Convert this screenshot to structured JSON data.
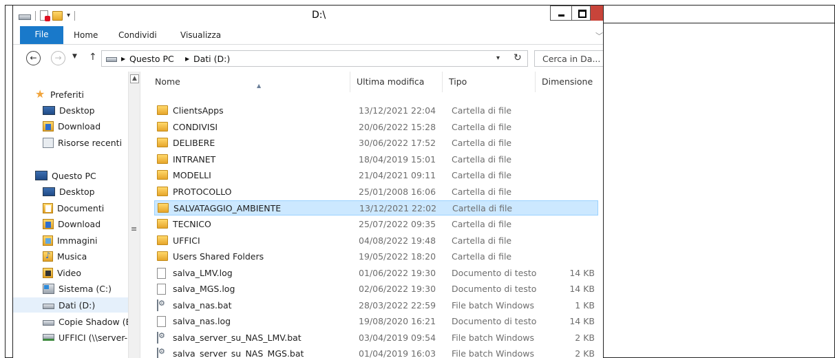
{
  "window": {
    "title": "D:\\",
    "ribbon_tabs": [
      "File",
      "Home",
      "Condividi",
      "Visualizza"
    ]
  },
  "addressbar": {
    "segments": [
      "Questo PC",
      "Dati (D:)"
    ],
    "search_placeholder": "Cerca in Da..."
  },
  "navpane": {
    "favorites_label": "Preferiti",
    "favorites": [
      "Desktop",
      "Download",
      "Risorse recenti"
    ],
    "thispc_label": "Questo PC",
    "thispc_items": [
      "Desktop",
      "Documenti",
      "Download",
      "Immagini",
      "Musica",
      "Video",
      "Sistema (C:)",
      "Dati (D:)",
      "Copie Shadow (E",
      "UFFICI (\\\\server-"
    ],
    "selected": "Dati (D:)"
  },
  "filelist": {
    "columns": [
      "Nome",
      "Ultima modifica",
      "Tipo",
      "Dimensione"
    ],
    "rows": [
      {
        "name": "ClientsApps",
        "date": "13/12/2021 22:04",
        "type": "Cartella di file",
        "size": "",
        "icon": "folder-icon"
      },
      {
        "name": "CONDIVISI",
        "date": "20/06/2022 15:28",
        "type": "Cartella di file",
        "size": "",
        "icon": "folder-icon"
      },
      {
        "name": "DELIBERE",
        "date": "30/06/2022 17:52",
        "type": "Cartella di file",
        "size": "",
        "icon": "folder-icon"
      },
      {
        "name": "INTRANET",
        "date": "18/04/2019 15:01",
        "type": "Cartella di file",
        "size": "",
        "icon": "folder-icon"
      },
      {
        "name": "MODELLI",
        "date": "21/04/2021 09:11",
        "type": "Cartella di file",
        "size": "",
        "icon": "folder-icon"
      },
      {
        "name": "PROTOCOLLO",
        "date": "25/01/2008 16:06",
        "type": "Cartella di file",
        "size": "",
        "icon": "folder-icon"
      },
      {
        "name": "SALVATAGGIO_AMBIENTE",
        "date": "13/12/2021 22:02",
        "type": "Cartella di file",
        "size": "",
        "icon": "folder-icon"
      },
      {
        "name": "TECNICO",
        "date": "25/07/2022 09:35",
        "type": "Cartella di file",
        "size": "",
        "icon": "folder-icon"
      },
      {
        "name": "UFFICI",
        "date": "04/08/2022 19:48",
        "type": "Cartella di file",
        "size": "",
        "icon": "folder-icon"
      },
      {
        "name": "Users Shared Folders",
        "date": "19/05/2022 18:20",
        "type": "Cartella di file",
        "size": "",
        "icon": "folder-icon"
      },
      {
        "name": "salva_LMV.log",
        "date": "01/06/2022 19:30",
        "type": "Documento di testo",
        "size": "14 KB",
        "icon": "text-file-icon"
      },
      {
        "name": "salva_MGS.log",
        "date": "02/06/2022 19:30",
        "type": "Documento di testo",
        "size": "14 KB",
        "icon": "text-file-icon"
      },
      {
        "name": "salva_nas.bat",
        "date": "28/03/2022 22:59",
        "type": "File batch Windows",
        "size": "1 KB",
        "icon": "batch-file-icon"
      },
      {
        "name": "salva_nas.log",
        "date": "19/08/2020 16:21",
        "type": "Documento di testo",
        "size": "14 KB",
        "icon": "text-file-icon"
      },
      {
        "name": "salva_server_su_NAS_LMV.bat",
        "date": "03/04/2019 09:54",
        "type": "File batch Windows",
        "size": "2 KB",
        "icon": "batch-file-icon"
      },
      {
        "name": "salva_server_su_NAS_MGS.bat",
        "date": "01/04/2019 16:03",
        "type": "File batch Windows",
        "size": "2 KB",
        "icon": "batch-file-icon"
      }
    ],
    "selected_row": "SALVATAGGIO_AMBIENTE"
  },
  "colors": {
    "file_tab": "#1979ca",
    "selection": "#cce8ff",
    "selection_border": "#99d1ff",
    "close_button": "#c8443a"
  }
}
